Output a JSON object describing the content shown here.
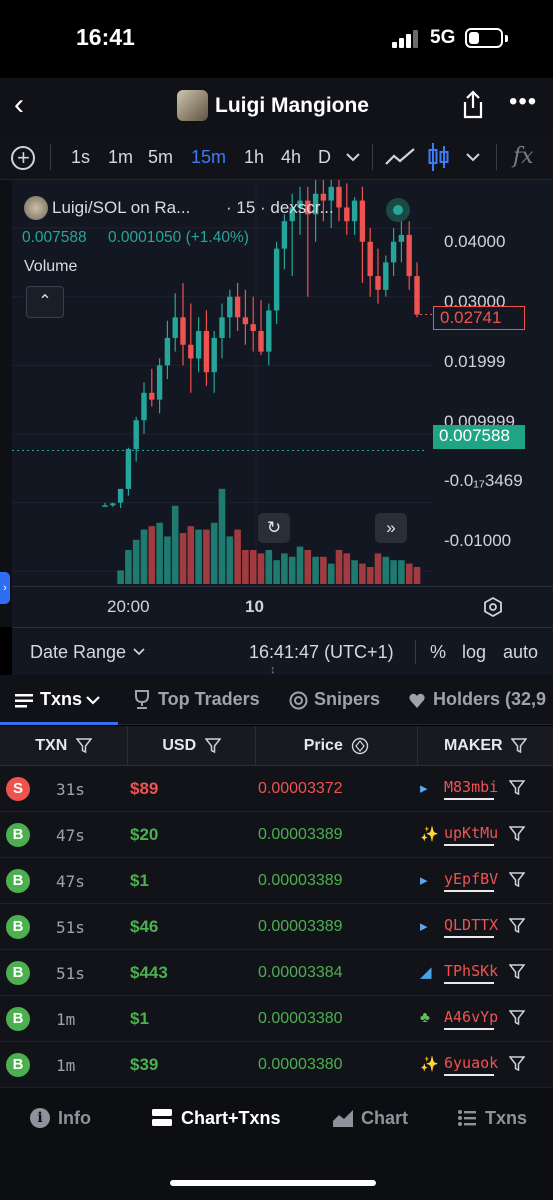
{
  "status": {
    "time": "16:41",
    "network": "5G"
  },
  "header": {
    "title": "Luigi Mangione",
    "back_icon": "chevron-left-icon",
    "share_icon": "share-icon",
    "more_icon": "more-dots-icon"
  },
  "toolbar": {
    "timeframes": [
      "1s",
      "1m",
      "5m",
      "15m",
      "1h",
      "4h",
      "D"
    ],
    "active_timeframe": "15m",
    "fx_label": "fx"
  },
  "chart": {
    "legend_title": "Luigi/SOL on Ra...",
    "legend_interval": "· 15 · dexscr...",
    "legend_price": "0.007588",
    "legend_change": "0.0001050 (+1.40%)",
    "volume_label": "Volume",
    "current_price_tag": "0.02741",
    "last_price_tag": "0.007588",
    "y_axis_labels": [
      "0.04000",
      "0.03000",
      "0.01999",
      "0.009999",
      "-0.0₁₇3469",
      "-0.01000"
    ],
    "time_labels": [
      "20:00",
      "10"
    ],
    "colors": {
      "up": "#26a69a",
      "down": "#ef5350",
      "background": "#131722"
    }
  },
  "chart_data": {
    "type": "candlestick",
    "x_labels": [
      "20:00",
      "10"
    ],
    "candles": [
      {
        "o": -0.0005,
        "h": 0.0,
        "l": -0.0005,
        "c": -0.0004
      },
      {
        "o": -0.0004,
        "h": 0.0,
        "l": -0.0006,
        "c": -0.0001
      },
      {
        "o": 0.0,
        "h": 0.002,
        "l": -0.0008,
        "c": 0.002
      },
      {
        "o": 0.002,
        "h": 0.008,
        "l": 0.001,
        "c": 0.0078
      },
      {
        "o": 0.0078,
        "h": 0.0125,
        "l": 0.006,
        "c": 0.012
      },
      {
        "o": 0.012,
        "h": 0.0175,
        "l": 0.01,
        "c": 0.016
      },
      {
        "o": 0.016,
        "h": 0.0195,
        "l": 0.014,
        "c": 0.015
      },
      {
        "o": 0.015,
        "h": 0.021,
        "l": 0.013,
        "c": 0.02
      },
      {
        "o": 0.02,
        "h": 0.0265,
        "l": 0.018,
        "c": 0.024
      },
      {
        "o": 0.024,
        "h": 0.0305,
        "l": 0.022,
        "c": 0.027
      },
      {
        "o": 0.027,
        "h": 0.032,
        "l": 0.02,
        "c": 0.023
      },
      {
        "o": 0.023,
        "h": 0.029,
        "l": 0.016,
        "c": 0.021
      },
      {
        "o": 0.021,
        "h": 0.027,
        "l": 0.019,
        "c": 0.025
      },
      {
        "o": 0.025,
        "h": 0.028,
        "l": 0.017,
        "c": 0.019
      },
      {
        "o": 0.019,
        "h": 0.025,
        "l": 0.016,
        "c": 0.024
      },
      {
        "o": 0.024,
        "h": 0.029,
        "l": 0.021,
        "c": 0.027
      },
      {
        "o": 0.027,
        "h": 0.031,
        "l": 0.024,
        "c": 0.03
      },
      {
        "o": 0.03,
        "h": 0.032,
        "l": 0.025,
        "c": 0.027
      },
      {
        "o": 0.027,
        "h": 0.031,
        "l": 0.023,
        "c": 0.026
      },
      {
        "o": 0.026,
        "h": 0.03,
        "l": 0.022,
        "c": 0.025
      },
      {
        "o": 0.025,
        "h": 0.0295,
        "l": 0.0215,
        "c": 0.022
      },
      {
        "o": 0.022,
        "h": 0.029,
        "l": 0.02,
        "c": 0.028
      },
      {
        "o": 0.028,
        "h": 0.038,
        "l": 0.026,
        "c": 0.037
      },
      {
        "o": 0.037,
        "h": 0.042,
        "l": 0.034,
        "c": 0.041
      },
      {
        "o": 0.041,
        "h": 0.045,
        "l": 0.033,
        "c": 0.043
      },
      {
        "o": 0.043,
        "h": 0.046,
        "l": 0.039,
        "c": 0.044
      },
      {
        "o": 0.044,
        "h": 0.046,
        "l": 0.03,
        "c": 0.042
      },
      {
        "o": 0.042,
        "h": 0.047,
        "l": 0.038,
        "c": 0.045
      },
      {
        "o": 0.045,
        "h": 0.047,
        "l": 0.041,
        "c": 0.044
      },
      {
        "o": 0.044,
        "h": 0.047,
        "l": 0.04,
        "c": 0.046
      },
      {
        "o": 0.046,
        "h": 0.047,
        "l": 0.041,
        "c": 0.043
      },
      {
        "o": 0.043,
        "h": 0.0465,
        "l": 0.039,
        "c": 0.041
      },
      {
        "o": 0.041,
        "h": 0.0445,
        "l": 0.039,
        "c": 0.044
      },
      {
        "o": 0.044,
        "h": 0.046,
        "l": 0.032,
        "c": 0.038
      },
      {
        "o": 0.038,
        "h": 0.04,
        "l": 0.03,
        "c": 0.033
      },
      {
        "o": 0.033,
        "h": 0.037,
        "l": 0.029,
        "c": 0.031
      },
      {
        "o": 0.031,
        "h": 0.036,
        "l": 0.03,
        "c": 0.035
      },
      {
        "o": 0.035,
        "h": 0.04,
        "l": 0.033,
        "c": 0.038
      },
      {
        "o": 0.038,
        "h": 0.042,
        "l": 0.035,
        "c": 0.039
      },
      {
        "o": 0.039,
        "h": 0.041,
        "l": 0.031,
        "c": 0.033
      },
      {
        "o": 0.033,
        "h": 0.035,
        "l": 0.027,
        "c": 0.0274
      }
    ],
    "volume": [
      0,
      0,
      4,
      10,
      13,
      16,
      17,
      18,
      14,
      23,
      15,
      17,
      16,
      16,
      18,
      28,
      14,
      16,
      10,
      10,
      9,
      10,
      7,
      9,
      8,
      11,
      10,
      8,
      8,
      6,
      10,
      9,
      7,
      6,
      5,
      9,
      8,
      7,
      7,
      6,
      5
    ],
    "ylim": [
      -0.012,
      0.047
    ],
    "last_price": 0.007588,
    "current_price": 0.02741
  },
  "range_bar": {
    "date_range": "Date Range",
    "timestamp": "16:41:47 (UTC+1)",
    "percent": "%",
    "log": "log",
    "auto": "auto"
  },
  "tabs": [
    {
      "label": "Txns",
      "icon": "list-icon"
    },
    {
      "label": "Top Traders",
      "icon": "trophy-icon"
    },
    {
      "label": "Snipers",
      "icon": "target-icon"
    },
    {
      "label": "Holders (32,9",
      "icon": "heart-icon"
    }
  ],
  "table": {
    "headers": [
      "TXN",
      "USD",
      "Price",
      "MAKER"
    ],
    "rows": [
      {
        "type": "S",
        "age": "31s",
        "usd": "$89",
        "price": "0.00003372",
        "maker": "M83mbi",
        "maker_icon": "fish-icon"
      },
      {
        "type": "B",
        "age": "47s",
        "usd": "$20",
        "price": "0.00003389",
        "maker": "upKtMu",
        "maker_icon": "sparkle-icon"
      },
      {
        "type": "B",
        "age": "47s",
        "usd": "$1",
        "price": "0.00003389",
        "maker": "yEpfBV",
        "maker_icon": "fish-icon"
      },
      {
        "type": "B",
        "age": "51s",
        "usd": "$46",
        "price": "0.00003389",
        "maker": "QLDTTX",
        "maker_icon": "fish-icon"
      },
      {
        "type": "B",
        "age": "51s",
        "usd": "$443",
        "price": "0.00003384",
        "maker": "TPhSKk",
        "maker_icon": "dolphin-icon"
      },
      {
        "type": "B",
        "age": "1m",
        "usd": "$1",
        "price": "0.00003380",
        "maker": "A46vYp",
        "maker_icon": "frog-icon"
      },
      {
        "type": "B",
        "age": "1m",
        "usd": "$39",
        "price": "0.00003380",
        "maker": "6yuaok",
        "maker_icon": "sparkle-icon"
      }
    ],
    "colors": {
      "sell": "#ef5350",
      "buy": "#4caf50"
    }
  },
  "bottom_nav": [
    {
      "label": "Info",
      "icon": "info-icon"
    },
    {
      "label": "Chart+Txns",
      "icon": "chart-txns-icon"
    },
    {
      "label": "Chart",
      "icon": "chart-icon"
    },
    {
      "label": "Txns",
      "icon": "list-icon"
    }
  ]
}
